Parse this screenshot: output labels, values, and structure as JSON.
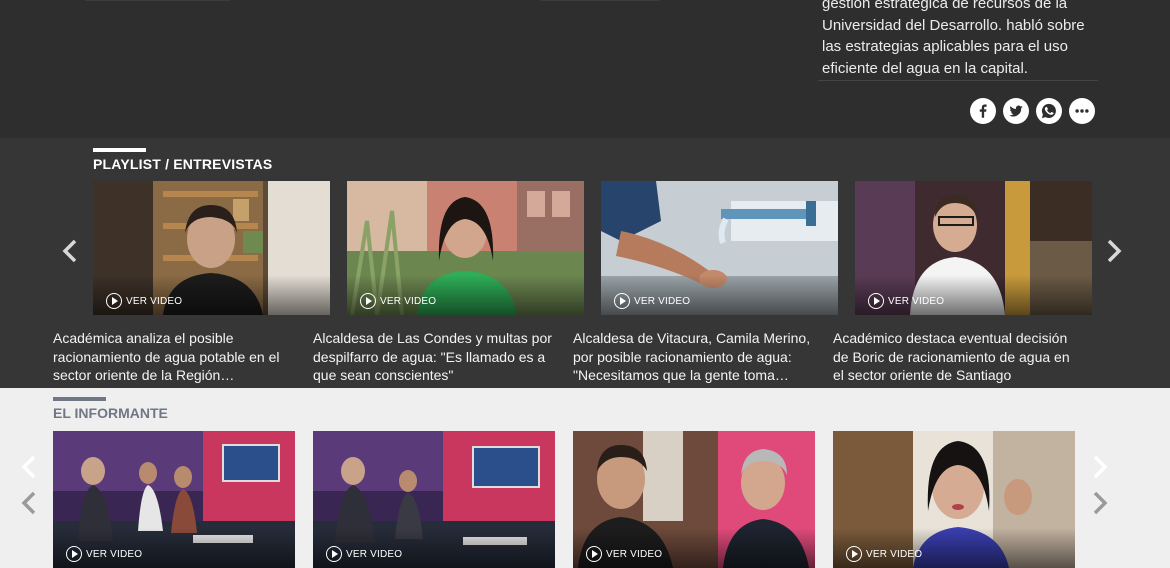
{
  "article": {
    "description": "gestión estratégica de recursos de la Universidad del Desarrollo. habló sobre las estrategias aplicables para el uso eficiente del agua en la capital."
  },
  "share": [
    {
      "name": "facebook",
      "icon": "facebook-icon"
    },
    {
      "name": "twitter",
      "icon": "twitter-icon"
    },
    {
      "name": "whatsapp",
      "icon": "whatsapp-icon"
    },
    {
      "name": "more",
      "icon": "more-icon"
    }
  ],
  "playlist": {
    "title": "PLAYLIST / ENTREVISTAS",
    "items": [
      {
        "title": "Académica analiza el posible racionamiento de agua potable en el sector oriente de la Región…",
        "video_label": "VER VIDEO"
      },
      {
        "title": "Alcaldesa de Las Condes y multas por despilfarro de agua: \"Es llamado es a que sean conscientes\"",
        "video_label": "VER VIDEO"
      },
      {
        "title": "Alcaldesa de Vitacura, Camila Merino, por posible racionamiento de agua: \"Necesitamos que la gente toma…",
        "video_label": "VER VIDEO"
      },
      {
        "title": "Académico destaca eventual decisión de Boric de racionamiento de agua en el sector oriente de Santiago",
        "video_label": "VER VIDEO"
      }
    ]
  },
  "informante": {
    "title": "EL INFORMANTE",
    "items": [
      {
        "video_label": "VER VIDEO"
      },
      {
        "video_label": "VER VIDEO"
      },
      {
        "video_label": "VER VIDEO"
      },
      {
        "video_label": "VER VIDEO"
      }
    ]
  },
  "colors": {
    "top_bg": "#2e2e2e",
    "playlist_bg": "#363636",
    "informante_bg": "#efefef",
    "informante_accent": "#6f7785"
  }
}
